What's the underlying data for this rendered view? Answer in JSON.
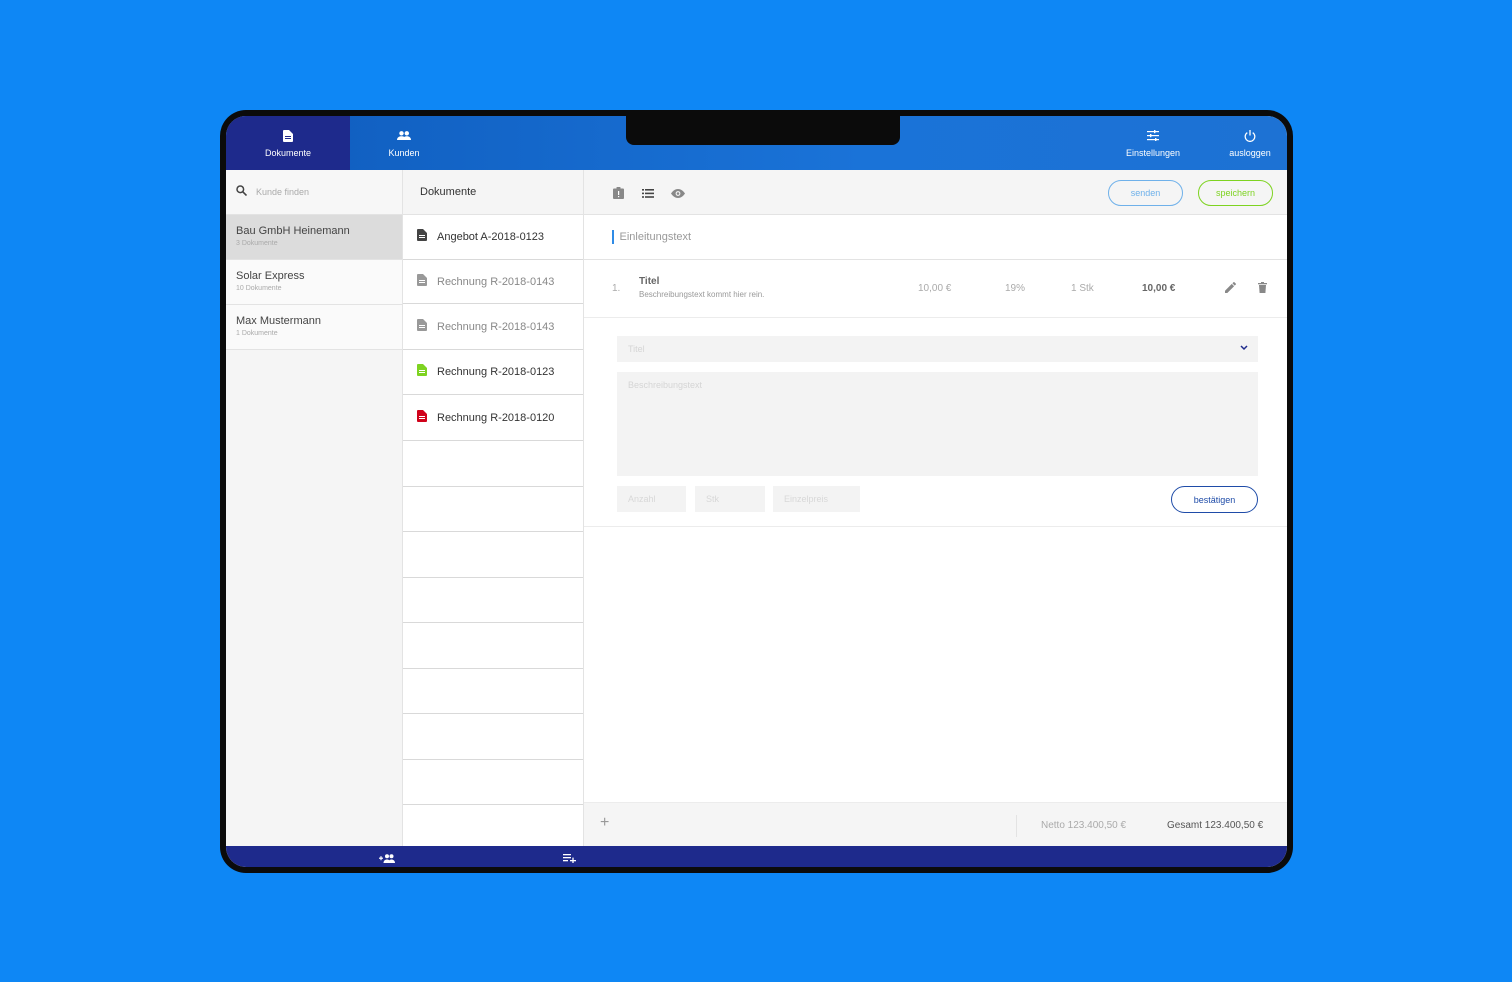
{
  "colors": {
    "background": "#0e87f5",
    "nav_active": "#1e2a8c",
    "send": "#6fb1ea",
    "save": "#7ed321",
    "confirm": "#1f4ca8",
    "doc_grey": "#999999",
    "doc_dark": "#444444",
    "doc_green": "#7ed321",
    "doc_red": "#d0021b"
  },
  "topnav": {
    "documents": {
      "label": "Dokumente",
      "icon": "file-icon"
    },
    "customers": {
      "label": "Kunden",
      "icon": "people-icon"
    },
    "settings": {
      "label": "Einstellungen",
      "icon": "sliders-icon"
    },
    "logout": {
      "label": "ausloggen",
      "icon": "power-icon"
    }
  },
  "search": {
    "placeholder": "Kunde finden"
  },
  "customers": [
    {
      "name": "Bau GmbH Heinemann",
      "count": "3 Dokumente",
      "active": true
    },
    {
      "name": "Solar Express",
      "count": "10 Dokumente",
      "active": false
    },
    {
      "name": "Max Mustermann",
      "count": "1 Dokumente",
      "active": false
    }
  ],
  "documents_header": "Dokumente",
  "documents": [
    {
      "title": "Angebot A-2018-0123",
      "status": "dark"
    },
    {
      "title": "Rechnung R-2018-0143",
      "status": "grey"
    },
    {
      "title": "Rechnung R-2018-0143",
      "status": "grey"
    },
    {
      "title": "Rechnung R-2018-0123",
      "status": "green"
    },
    {
      "title": "Rechnung R-2018-0120",
      "status": "red"
    }
  ],
  "toolbar": {
    "send_label": "senden",
    "save_label": "speichern"
  },
  "intro": {
    "text": "Einleitungstext"
  },
  "item": {
    "number": "1.",
    "title": "Titel",
    "description": "Beschreibungstext kommt hier rein.",
    "net": "10,00 €",
    "vat": "19%",
    "qty": "1 Stk",
    "total": "10,00 €"
  },
  "editor": {
    "title_placeholder": "Titel",
    "description_placeholder": "Beschreibungstext",
    "amount_placeholder": "Anzahl",
    "unit_placeholder": "Stk",
    "price_placeholder": "Einzelpreis",
    "confirm_label": "bestätigen"
  },
  "footer": {
    "plus": "+",
    "netto": "Netto 123.400,50 €",
    "gesamt": "Gesamt 123.400,50 €"
  }
}
